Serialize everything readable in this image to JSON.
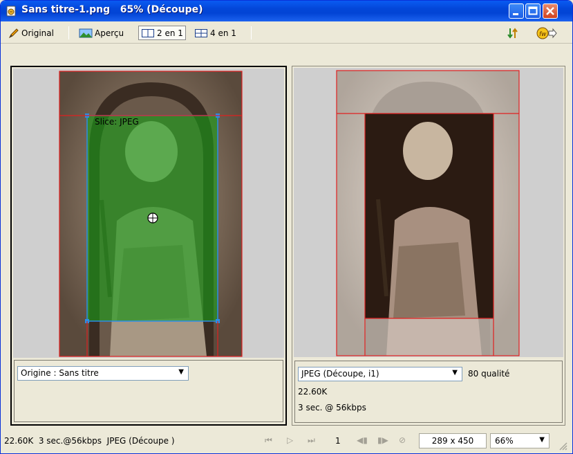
{
  "window": {
    "title": "Sans titre-1.png   65% (Découpe)"
  },
  "toolbar": {
    "original_label": "Original",
    "preview_label": "Aperçu",
    "two_up_label": "2 en 1",
    "four_up_label": "4 en 1"
  },
  "left_pane": {
    "slice_label": "Slice: JPEG",
    "origin_select": "Origine : Sans titre"
  },
  "right_pane": {
    "format_select": "JPEG (Découpe, i1)",
    "quality": "80 qualité",
    "file_size": "22.60K",
    "download_time": "3 sec. @ 56kbps"
  },
  "status_bar": {
    "summary": "22.60K  3 sec.@56kbps  JPEG (Découpe )",
    "frame_number": "1",
    "dimensions": "289 x 450",
    "zoom": "66%"
  },
  "colors": {
    "title_bar": "#0346d8",
    "slice_overlay": "#18a018",
    "slice_border": "#2a8ee8",
    "guide_red": "#e02020"
  },
  "icons": {
    "app": "fireworks-document-icon",
    "minimize": "minimize-icon",
    "maximize": "maximize-icon",
    "close": "close-icon",
    "original": "pencil-icon",
    "preview": "landscape-preview-icon",
    "two_up": "two-up-icon",
    "four_up": "four-up-icon",
    "sort": "sort-arrows-icon",
    "export": "fireworks-export-icon"
  }
}
